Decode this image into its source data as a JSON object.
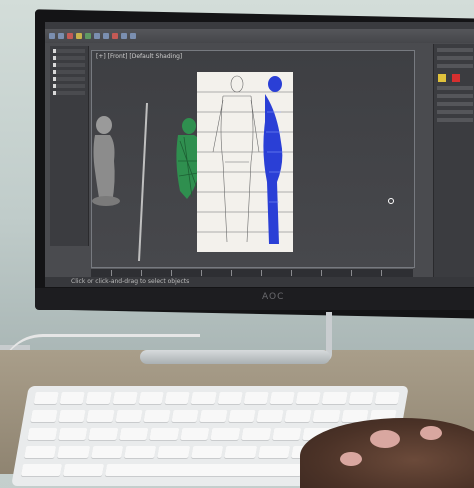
{
  "monitor": {
    "brand": "AOC"
  },
  "app": {
    "viewport_label": "[+] [Front] [Default Shading]",
    "status_text": "Click or click-and-drag to select objects"
  },
  "colors": {
    "screen_bg": "#4a4b4f",
    "model_blue": "#2a3fd6",
    "model_green": "#2f8f4f",
    "model_grey": "#9a9a9a",
    "plush": "#4b3227"
  },
  "icons": [
    "select-icon",
    "move-icon",
    "rotate-icon",
    "scale-icon"
  ]
}
